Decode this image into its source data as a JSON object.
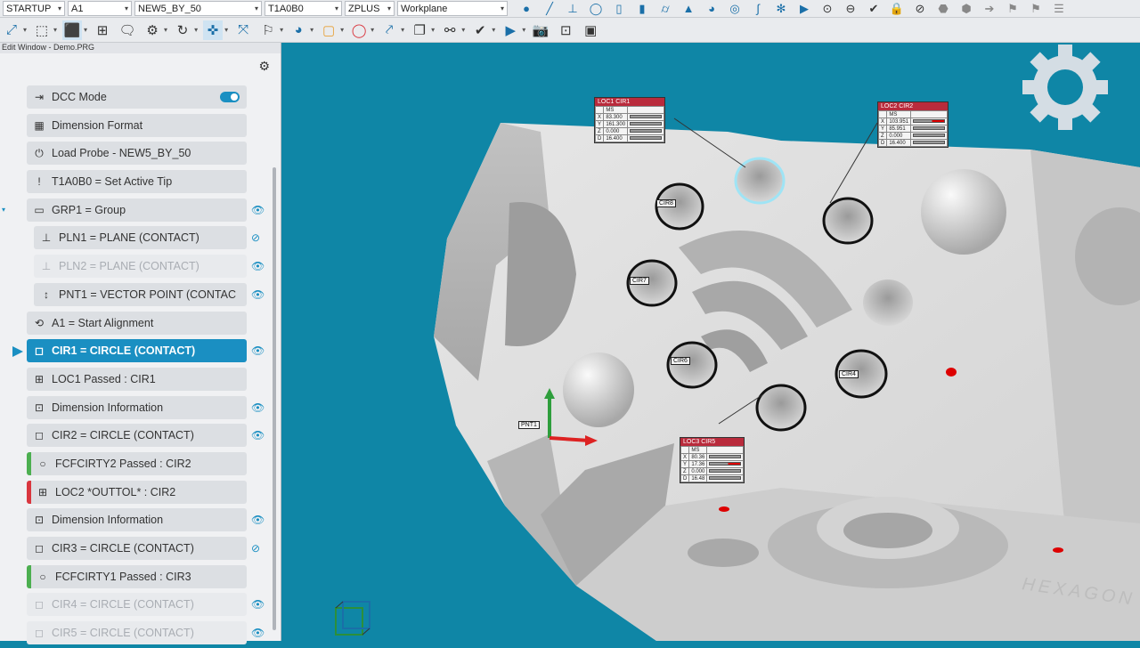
{
  "toolbar1": {
    "dropdowns": [
      {
        "value": "STARTUP",
        "width": 70
      },
      {
        "value": "A1",
        "width": 72
      },
      {
        "value": "NEW5_BY_50",
        "width": 143
      },
      {
        "value": "T1A0B0",
        "width": 87
      },
      {
        "value": "ZPLUS",
        "width": 56
      },
      {
        "value": "Workplane",
        "width": 124
      }
    ]
  },
  "panel": {
    "title": "Edit Window - Demo.PRG",
    "items": [
      {
        "label": "DCC Mode",
        "icon": "dcc-mode-icon",
        "glyph": "⇥",
        "toggle": true
      },
      {
        "label": "Dimension Format",
        "icon": "dimension-format-icon",
        "glyph": "▦"
      },
      {
        "label": "Load Probe - NEW5_BY_50",
        "icon": "probe-icon",
        "glyph": "⏻"
      },
      {
        "label": "T1A0B0 = Set Active Tip",
        "icon": "tip-icon",
        "glyph": "!"
      },
      {
        "label": "GRP1 = Group",
        "icon": "folder-icon",
        "glyph": "▭",
        "eye": "👁",
        "caret": true
      },
      {
        "label": "PLN1 = PLANE (CONTACT)",
        "icon": "plane-icon",
        "glyph": "⊥",
        "eye": "⊘",
        "sub": true
      },
      {
        "label": "PLN2 = PLANE (CONTACT)",
        "icon": "plane-icon",
        "glyph": "⊥",
        "eye": "👁",
        "sub": true,
        "dim": true
      },
      {
        "label": "PNT1 = VECTOR POINT (CONTAC",
        "icon": "vector-point-icon",
        "glyph": "↕",
        "eye": "👁",
        "sub": true
      },
      {
        "label": "A1 = Start Alignment",
        "icon": "alignment-icon",
        "glyph": "⟲"
      },
      {
        "label": "CIR1 = CIRCLE (CONTACT)",
        "icon": "circle-icon",
        "glyph": "◻",
        "eye": "👁",
        "active": true
      },
      {
        "label": "LOC1 Passed : CIR1",
        "icon": "location-icon",
        "glyph": "⊞"
      },
      {
        "label": "Dimension Information",
        "icon": "dimension-info-icon",
        "glyph": "⊡",
        "eye": "👁"
      },
      {
        "label": "CIR2 = CIRCLE (CONTACT)",
        "icon": "circle-icon",
        "glyph": "◻",
        "eye": "👁"
      },
      {
        "label": "FCFCIRTY2 Passed : CIR2",
        "icon": "circularity-icon",
        "glyph": "○",
        "flag": "#4caf50"
      },
      {
        "label": "LOC2 *OUTTOL* : CIR2",
        "icon": "location-icon",
        "glyph": "⊞",
        "flag": "#d9363e"
      },
      {
        "label": "Dimension Information",
        "icon": "dimension-info-icon",
        "glyph": "⊡",
        "eye": "👁"
      },
      {
        "label": "CIR3 = CIRCLE (CONTACT)",
        "icon": "circle-icon",
        "glyph": "◻",
        "eye": "⊘"
      },
      {
        "label": "FCFCIRTY1 Passed : CIR3",
        "icon": "circularity-icon",
        "glyph": "○",
        "flag": "#4caf50"
      },
      {
        "label": "CIR4 = CIRCLE (CONTACT)",
        "icon": "circle-icon",
        "glyph": "◻",
        "eye": "👁",
        "dim": true
      },
      {
        "label": "CIR5 = CIRCLE (CONTACT)",
        "icon": "circle-icon",
        "glyph": "◻",
        "eye": "👁",
        "dim": true
      }
    ]
  },
  "viewport": {
    "labels": {
      "loc1": {
        "title": "LOC1 CIR1",
        "head": "MS",
        "rows": [
          [
            "X",
            "83.300"
          ],
          [
            "Y",
            "161.300"
          ],
          [
            "Z",
            "0.000"
          ],
          [
            "D",
            "16.400"
          ]
        ]
      },
      "loc2": {
        "title": "LOC2 CIR2",
        "head": "MS",
        "rows": [
          [
            "X",
            "103.951"
          ],
          [
            "Y",
            "85.951"
          ],
          [
            "Z",
            "0.000"
          ],
          [
            "D",
            "16.400"
          ]
        ]
      },
      "loc3": {
        "title": "LOC3 CIR5",
        "head": "MS",
        "rows": [
          [
            "X",
            "80.36"
          ],
          [
            "Y",
            "17.36"
          ],
          [
            "Z",
            "0.000"
          ],
          [
            "D",
            "16.48"
          ]
        ]
      }
    },
    "features": [
      "CIR8",
      "CIR7",
      "CIR6",
      "CIR4",
      "PNT1"
    ],
    "watermark": "HEXAGON"
  }
}
